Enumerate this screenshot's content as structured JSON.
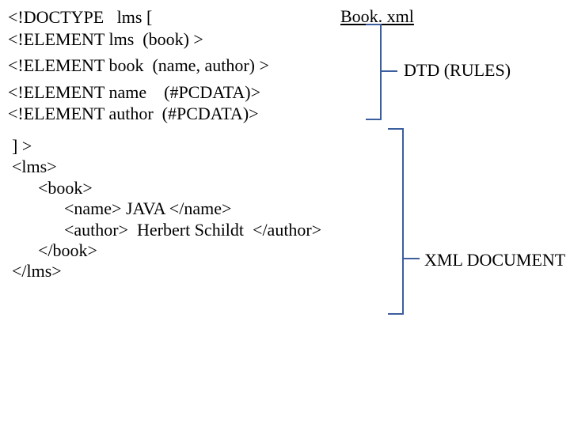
{
  "title": "Book. xml",
  "dtd": {
    "line1": "<!DOCTYPE   lms [",
    "line2": "<!ELEMENT lms  (book) >",
    "line3": "<!ELEMENT book  (name, author) >",
    "line4": "<!ELEMENT name    (#PCDATA)>",
    "line5": "<!ELEMENT author  (#PCDATA)>"
  },
  "xml": {
    "line1": "] >",
    "line2": "<lms>",
    "line3": "      <book>",
    "line4": "            <name> JAVA </name>",
    "line5": "            <author>  Herbert Schildt  </author>",
    "line6": "      </book>",
    "line7": "</lms>"
  },
  "labels": {
    "dtd": "DTD (RULES)",
    "xml": "XML DOCUMENT"
  }
}
